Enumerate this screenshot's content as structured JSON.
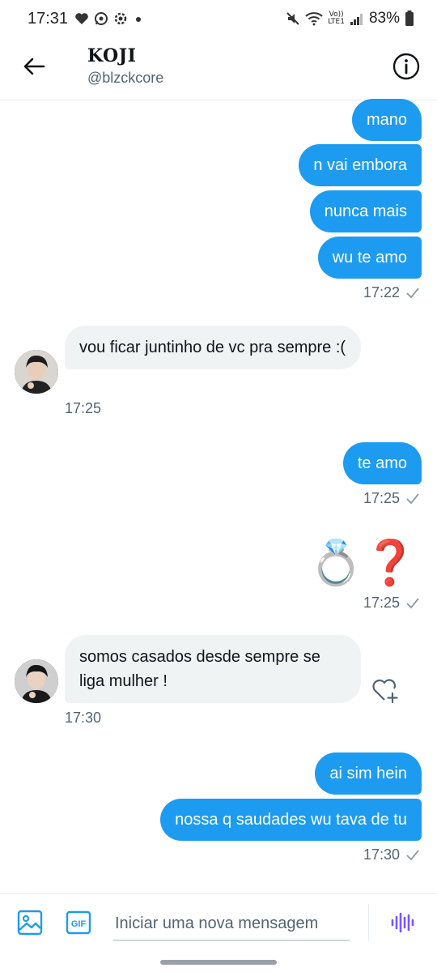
{
  "status_bar": {
    "time": "17:31",
    "battery": "83%",
    "network_top": "Vo))",
    "network_bottom": "LTE1"
  },
  "header": {
    "name": "KOJI",
    "handle": "@blzckcore"
  },
  "messages": {
    "out1": "mano",
    "out2": "n vai embora",
    "out3": "nunca mais",
    "out4": "wu te amo",
    "time1": "17:22",
    "in1": "vou ficar juntinho de vc pra sempre :(",
    "time2": "17:25",
    "out5": "te amo",
    "time3": "17:25",
    "emoji": "💍❓",
    "time4": "17:25",
    "in2": "somos casados desde sempre se liga mulher !",
    "time5": "17:30",
    "out6": "ai sim hein",
    "out7": "nossa q saudades wu tava de tu",
    "time6": "17:30"
  },
  "composer": {
    "placeholder": "Iniciar uma nova mensagem",
    "gif_label": "GIF"
  },
  "colors": {
    "accent": "#1d9bf0",
    "incoming_bg": "#eff3f4",
    "meta_text": "#536471"
  },
  "icons": {
    "back": "arrow-left-icon",
    "info": "info-icon",
    "image": "image-icon",
    "gif": "gif-icon",
    "voice": "voice-icon",
    "read": "check-icon",
    "react": "heart-plus-icon"
  }
}
